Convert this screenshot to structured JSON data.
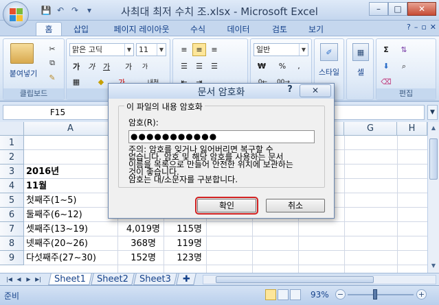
{
  "window": {
    "title": "사최대 최저 수치 조.xlsx - Microsoft Excel",
    "minimize": "–",
    "maximize": "□",
    "close": "✕"
  },
  "qat": {
    "save": "💾",
    "undo": "↶",
    "redo": "↷",
    "more": "▾"
  },
  "ribbon_tabs": [
    "홈",
    "삽입",
    "페이지 레이아웃",
    "수식",
    "데이터",
    "검토",
    "보기"
  ],
  "ribbon": {
    "paste_label": "붙여넣기",
    "clipboard_label": "클립보드",
    "font_name": "맑은 고딕",
    "font_size": "11",
    "bold": "가",
    "italic": "가",
    "grow_font": "가",
    "shrink_font": "가",
    "phonetic": "내천",
    "number_format": "일반",
    "currency": "₩",
    "percent": "%",
    "comma": ",",
    "style_label": "스타일",
    "cells_label": "셀",
    "editing_label": "편집",
    "font_group_label": "글",
    "sigma": "Σ"
  },
  "formula_bar": {
    "name_box": "F15",
    "formula": ""
  },
  "grid": {
    "columns": [
      "A",
      "B",
      "C",
      "D",
      "E",
      "F",
      "G",
      "H"
    ],
    "rows": [
      "1",
      "2",
      "3",
      "4",
      "5",
      "6",
      "7",
      "8",
      "9"
    ],
    "cells": {
      "a3": "2016년",
      "a4": "11월",
      "a5": "첫째주(1~5)",
      "a6": "둘째주(6~12)",
      "a7": "셋째주(13~19)",
      "a8": "넷째주(20~26)",
      "a9": "다섯째주(27~30)",
      "b7": "4,019명",
      "b8": "368명",
      "b9": "152명",
      "c7": "115명",
      "c8": "119명",
      "c9": "123명"
    }
  },
  "sheet_tabs": [
    "Sheet1",
    "Sheet2",
    "Sheet3"
  ],
  "status": {
    "text": "준비",
    "zoom": "93%",
    "zoom_minus": "−",
    "zoom_plus": "+"
  },
  "dialog": {
    "title": "문서 암호화",
    "help": "?",
    "close": "✕",
    "group_label": "이 파일의 내용 암호화",
    "password_label": "암호(R):",
    "password_value": "●●●●●●●●●●●",
    "note_lines": [
      "주의: 암호를 잊거나 잃어버리면 복구할 수",
      "없습니다. 암호 및 해당 암호를 사용하는 문서",
      "이름을 목록으로 만들어 안전한 위치에 보관하는",
      "것이 좋습니다.",
      "암호는 대/소문자를 구분합니다."
    ],
    "ok": "확인",
    "cancel": "취소"
  },
  "colors": {
    "highlight": "#d01f1f",
    "ribbon": "#dbe7f6"
  }
}
